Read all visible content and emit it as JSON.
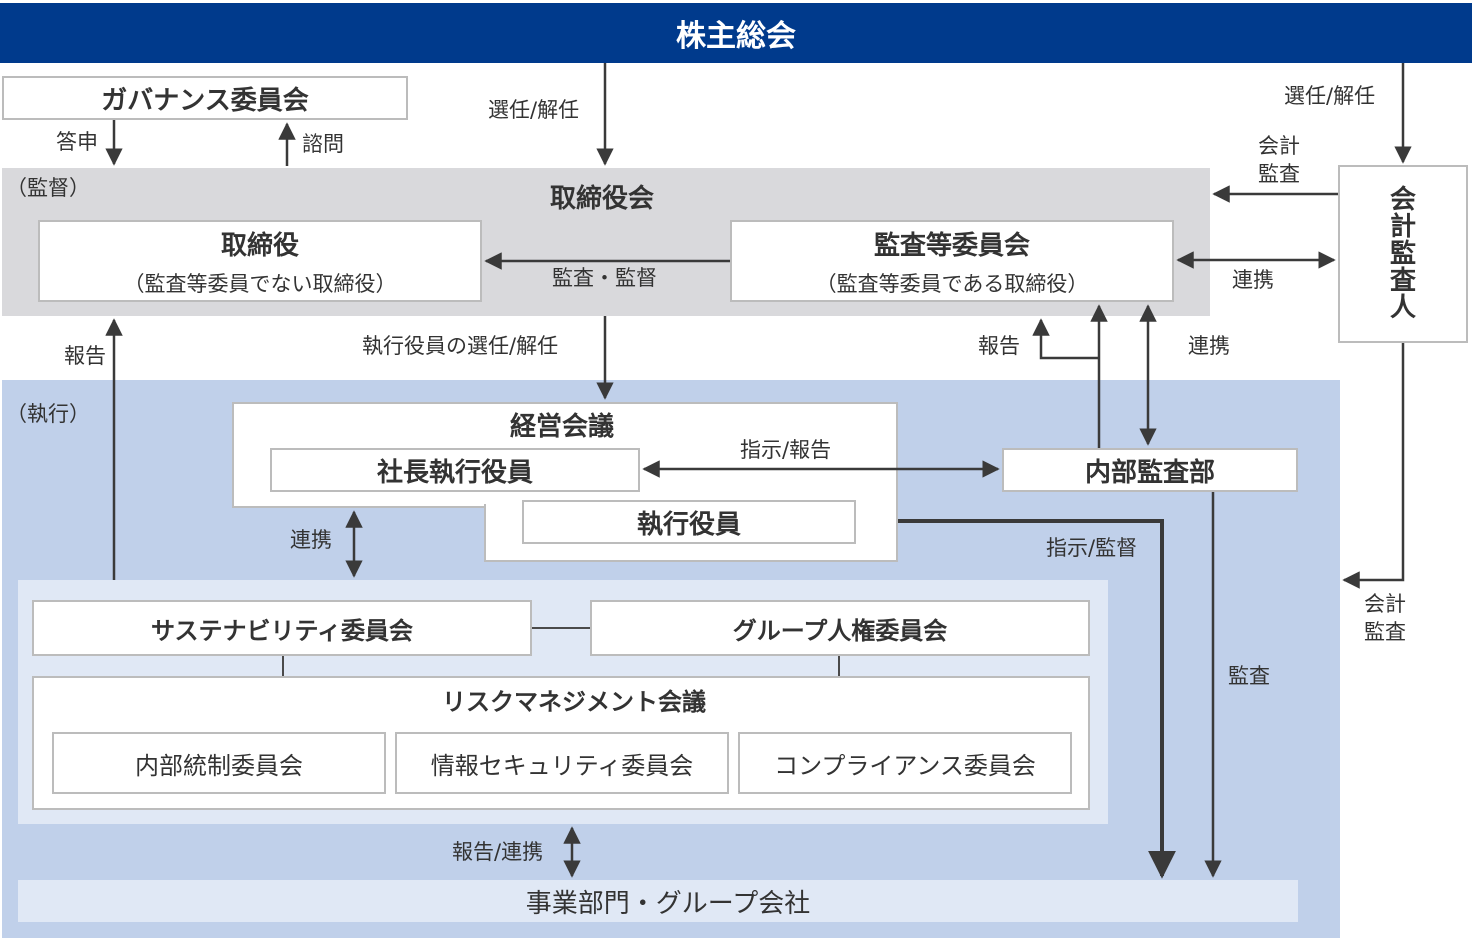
{
  "header": {
    "title": "株主総会"
  },
  "governance": {
    "title": "ガバナンス委員会",
    "answer": "答申",
    "consult": "諮問"
  },
  "labels": {
    "elect_dismiss_board": "選任/解任",
    "elect_dismiss_auditor": "選任/解任",
    "accounting_audit_top_1": "会計",
    "accounting_audit_top_2": "監査",
    "audit_supervise": "監査・監督",
    "cooperation_auditor": "連携",
    "exec_officer_elect": "執行役員の選任/解任",
    "report_left": "報告",
    "report_internal": "報告",
    "cooperation_internal": "連携",
    "instruct_report": "指示/報告",
    "instruct_supervise": "指示/監督",
    "cooperation_exec": "連携",
    "audit_right": "監査",
    "accounting_audit_bottom_1": "会計",
    "accounting_audit_bottom_2": "監査",
    "report_cooperate": "報告/連携"
  },
  "supervision": {
    "section_label": "（監督）",
    "board": "取締役会",
    "directors": {
      "title": "取締役",
      "subtitle": "（監査等委員でない取締役）"
    },
    "audit_committee": {
      "title": "監査等委員会",
      "subtitle": "（監査等委員である取締役）"
    }
  },
  "auditor": {
    "chars": [
      "会",
      "計",
      "監",
      "査",
      "人"
    ]
  },
  "execution": {
    "section_label": "（執行）",
    "management_meeting": "経営会議",
    "president": "社長執行役員",
    "officers": "執行役員",
    "internal_audit": "内部監査部",
    "sustainability": "サステナビリティ委員会",
    "human_rights": "グループ人権委員会",
    "risk_meeting": "リスクマネジメント会議",
    "internal_control": "内部統制委員会",
    "info_security": "情報セキュリティ委員会",
    "compliance": "コンプライアンス委員会",
    "business_units": "事業部門・グループ会社"
  },
  "colors": {
    "header": "#003a8c",
    "supervision_bg": "#d9d9dc",
    "execution_bg": "#c0d0ea",
    "committee_bg": "#e0e8f5",
    "arrow": "#3a3a3a"
  }
}
